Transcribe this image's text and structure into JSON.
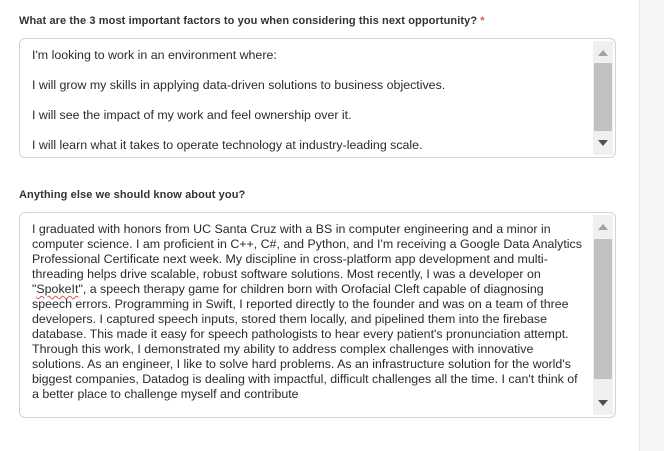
{
  "questions": [
    {
      "label": "What are the 3 most important factors to you when considering this next opportunity?",
      "required_marker": "*",
      "answer_paragraphs": [
        "I'm looking to work in an environment where:",
        "I will grow my skills in applying data-driven solutions to business objectives.",
        "I will see the impact of my work and feel ownership over it.",
        "I will learn what it takes to operate technology at industry-leading scale."
      ]
    },
    {
      "label": "Anything else we should know about you?",
      "answer_before": "I graduated with honors from UC Santa Cruz with a BS in computer engineering and a minor in computer science. I am proficient in C++, C#, and Python, and I'm receiving a Google Data Analytics Professional Certificate next week. My discipline in cross-platform app development and multi-threading helps drive scalable, robust software solutions. Most recently, I was a developer on \"",
      "answer_misspelled": "SpokeIt",
      "answer_after": "\", a speech therapy game for children born with Orofacial Cleft capable of diagnosing speech errors. Programming in Swift, I reported directly to the founder and was on a team of three developers. I captured speech inputs, stored them locally, and pipelined them into the firebase database. This made it easy for speech pathologists to hear every patient's pronunciation attempt. Through this work, I demonstrated my ability to address complex challenges with innovative solutions. As an engineer, I like to solve hard problems. As an infrastructure solution for the world's biggest companies, Datadog is dealing with impactful, difficult challenges all the time. I can't think of a better place to challenge myself and contribute"
    }
  ],
  "colors": {
    "required": "#e0524f",
    "label": "#333333",
    "text": "#2b2b2b",
    "border": "#d3d3d3",
    "scroll_thumb": "#c1c1c1"
  },
  "icons": [
    "scroll-up-arrow-icon",
    "scroll-down-arrow-icon"
  ]
}
